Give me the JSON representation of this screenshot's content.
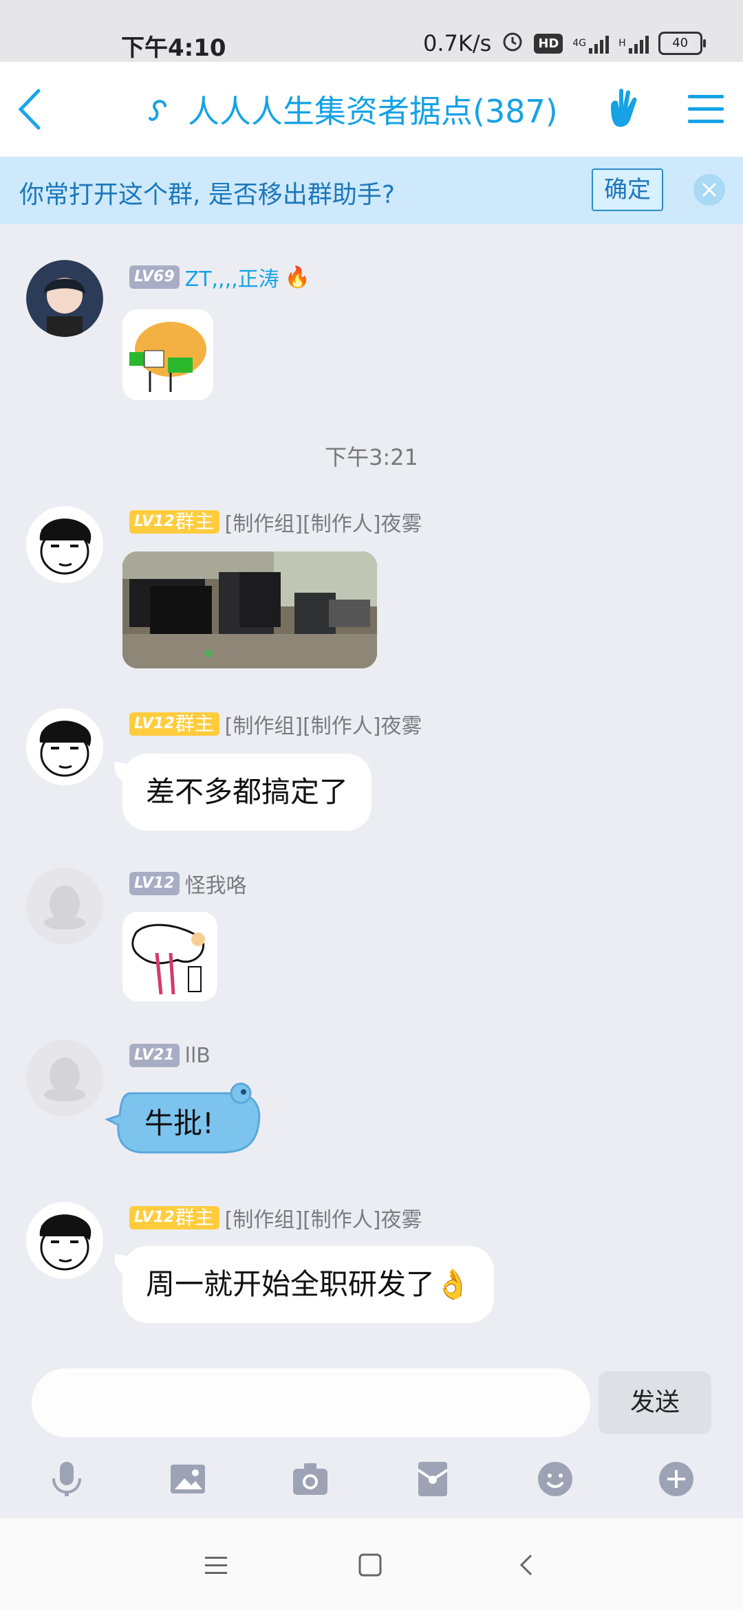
{
  "status": {
    "time": "下午4:10",
    "speed": "0.7K/s",
    "hd": "HD",
    "net1": "4G",
    "net2": "H",
    "battery": "40"
  },
  "header": {
    "title": "人人人生集资者据点(387)"
  },
  "banner": {
    "text": "你常打开这个群, 是否移出群助手?",
    "confirm": "确定"
  },
  "messages": [
    {
      "level": "LV69",
      "name": "ZT,,,,正涛",
      "type": "sticker"
    },
    {
      "separator": "下午3:21"
    },
    {
      "level": "LV12",
      "role": "群主",
      "name": "[制作组][制作人]夜雾",
      "type": "image"
    },
    {
      "level": "LV12",
      "role": "群主",
      "name": "[制作组][制作人]夜雾",
      "text": "差不多都搞定了"
    },
    {
      "level": "LV12",
      "name": "怪我咯",
      "type": "sticker"
    },
    {
      "level": "LV21",
      "name": "llB",
      "text": "牛批!"
    },
    {
      "level": "LV12",
      "role": "群主",
      "name": "[制作组][制作人]夜雾",
      "text": "周一就开始全职研发了👌"
    }
  ],
  "composer": {
    "send": "发送",
    "placeholder": ""
  },
  "colors": {
    "accent": "#16a2e5",
    "banner": "#cde9fb",
    "gold": "#ffcc3d",
    "bg": "#ecedf2"
  },
  "icons": [
    "mic-icon",
    "image-icon",
    "camera-icon",
    "red-packet-icon",
    "emoji-icon",
    "plus-icon"
  ]
}
